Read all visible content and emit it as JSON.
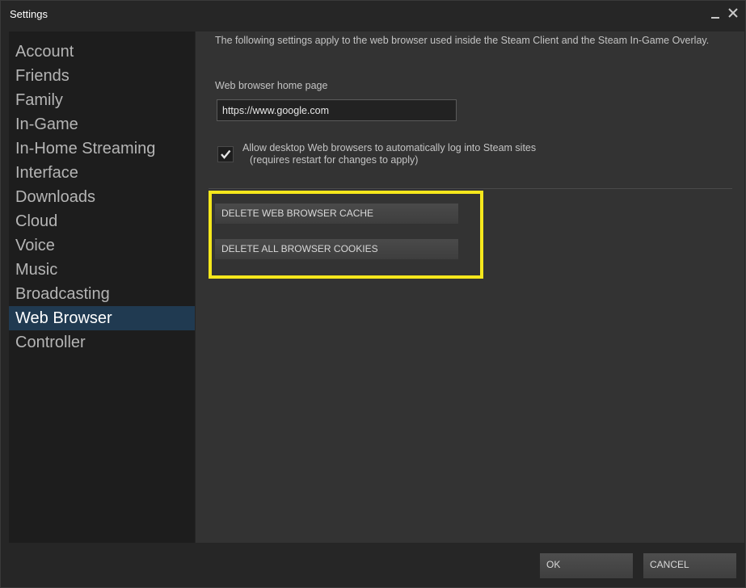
{
  "window": {
    "title": "Settings"
  },
  "sidebar": {
    "items": [
      {
        "label": "Account"
      },
      {
        "label": "Friends"
      },
      {
        "label": "Family"
      },
      {
        "label": "In-Game"
      },
      {
        "label": "In-Home Streaming"
      },
      {
        "label": "Interface"
      },
      {
        "label": "Downloads"
      },
      {
        "label": "Cloud"
      },
      {
        "label": "Voice"
      },
      {
        "label": "Music"
      },
      {
        "label": "Broadcasting"
      },
      {
        "label": "Web Browser"
      },
      {
        "label": "Controller"
      }
    ],
    "selected": "Web Browser"
  },
  "content": {
    "intro": "The following settings apply to the web browser used inside the Steam Client and the Steam In-Game Overlay.",
    "home_page_label": "Web browser home page",
    "home_page_value": "https://www.google.com",
    "auto_login": {
      "checked": true,
      "label": "Allow desktop Web browsers to automatically log into Steam sites",
      "note": "(requires restart for changes to apply)"
    },
    "buttons": {
      "delete_cache": "DELETE WEB BROWSER CACHE",
      "delete_cookies": "DELETE ALL BROWSER COOKIES"
    }
  },
  "footer": {
    "ok_label": "OK",
    "cancel_label": "CANCEL"
  },
  "colors": {
    "highlight": "#f5e71c",
    "selected_item": "#203a51",
    "panel": "#333333",
    "sidebar": "#1d1d1d"
  },
  "icons": {
    "minimize": "minimize-icon",
    "close": "close-icon",
    "check": "checkmark-icon"
  }
}
